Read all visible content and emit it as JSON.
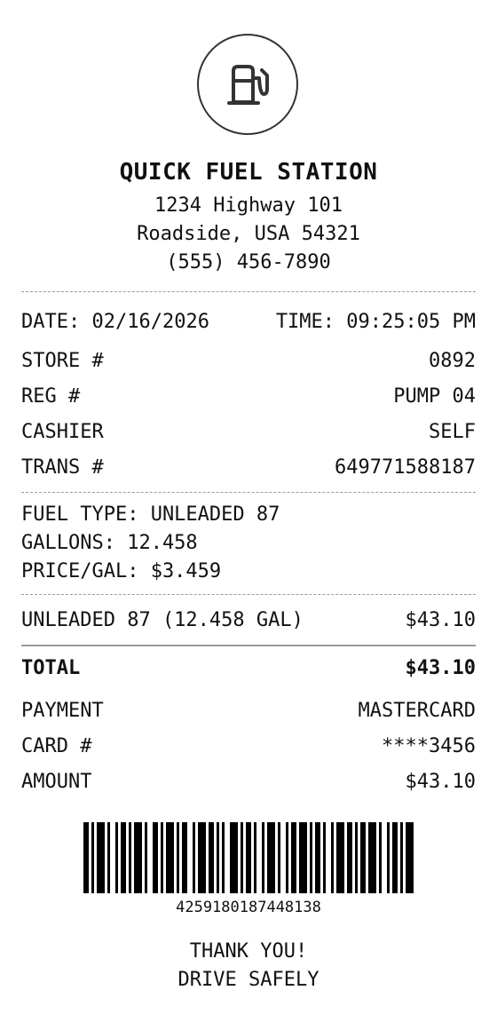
{
  "header": {
    "logo_icon": "fuel-pump-icon",
    "store_name": "QUICK FUEL STATION",
    "address_line1": "1234 Highway 101",
    "address_line2": "Roadside, USA 54321",
    "phone": "(555) 456-7890"
  },
  "meta": {
    "date_label": "DATE:",
    "date_value": "02/16/2026",
    "time_label": "TIME:",
    "time_value": "09:25:05 PM",
    "store_label": "STORE #",
    "store_value": "0892",
    "reg_label": "REG #",
    "reg_value": "PUMP 04",
    "cashier_label": "CASHIER",
    "cashier_value": "SELF",
    "trans_label": "TRANS #",
    "trans_value": "649771588187"
  },
  "fuel": {
    "type_line": "FUEL TYPE: UNLEADED 87",
    "gallons_line": "GALLONS: 12.458",
    "price_line": "PRICE/GAL: $3.459"
  },
  "item": {
    "description": "UNLEADED 87 (12.458 GAL)",
    "amount": "$43.10"
  },
  "totals": {
    "total_label": "TOTAL",
    "total_value": "$43.10",
    "payment_label": "PAYMENT",
    "payment_value": "MASTERCARD",
    "card_label": "CARD #",
    "card_value": "****3456",
    "amount_label": "AMOUNT",
    "amount_value": "$43.10"
  },
  "footer": {
    "barcode_number": "4259180187448138",
    "thanks_line1": "THANK YOU!",
    "thanks_line2": "DRIVE SAFELY"
  }
}
